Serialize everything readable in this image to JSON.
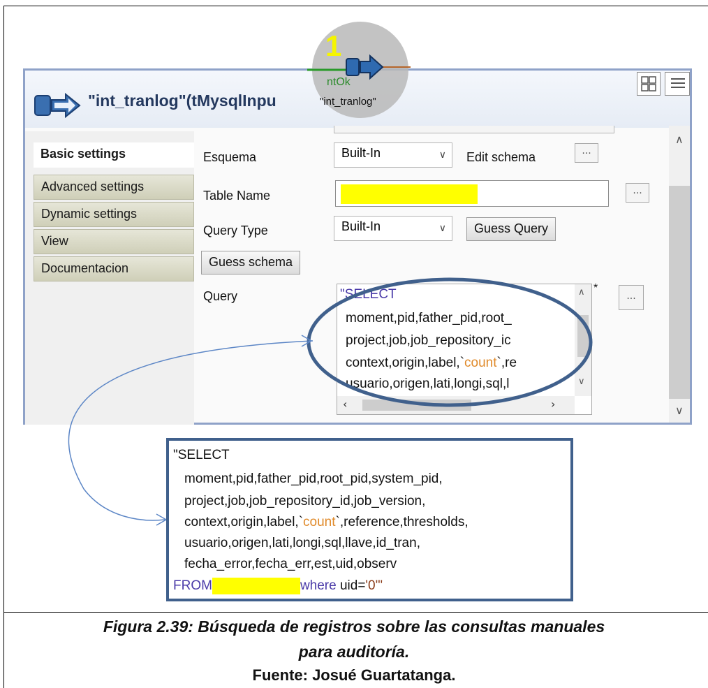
{
  "dialog": {
    "title": "\"int_tranlog\"(tMysqlInpu",
    "node_label": "\"int_tranlog\"",
    "connector_label": "ntOk",
    "step_number": "1"
  },
  "tabs": [
    {
      "label": "Basic settings"
    },
    {
      "label": "Advanced settings"
    },
    {
      "label": "Dynamic settings"
    },
    {
      "label": "View"
    },
    {
      "label": "Documentacion"
    }
  ],
  "fields": {
    "schema_label": "Esquema",
    "schema_value": "Built-In",
    "edit_schema": "Edit schema",
    "table_name_label": "Table Name",
    "query_type_label": "Query Type",
    "query_type_value": "Built-In",
    "guess_query": "Guess Query",
    "guess_schema": "Guess schema",
    "query_label": "Query",
    "dots": "...",
    "modified_marker": "*"
  },
  "query_preview": {
    "line1": "\"SELECT",
    "line2": "moment,pid,father_pid,root_",
    "line3": "project,job,job_repository_ic",
    "line4_a": "context,origin,label,`",
    "line4_b": "count",
    "line4_c": "`,re",
    "line5": "usuario,origen,lati,longi,sql,l"
  },
  "query_full": {
    "line1": "\"SELECT",
    "line2": "moment,pid,father_pid,root_pid,system_pid,",
    "line3": "project,job,job_repository_id,job_version,",
    "line4_a": "context,origin,label,`",
    "line4_b": "count",
    "line4_c": "`,reference,thresholds,",
    "line5": "usuario,origen,lati,longi,sql,llave,id_tran,",
    "line6": "fecha_error,fecha_err,est,uid,observ",
    "line7_from": "FROM",
    "line7_where": "where",
    "line7_uid": "uid=",
    "line7_value": "'0'\""
  },
  "caption": {
    "line1": "Figura 2.39: Búsqueda de registros sobre las consultas manuales",
    "line2": "para auditoría.",
    "source": "Fuente: Josué Guartatanga."
  },
  "colors": {
    "highlight": "#ffff00",
    "keyword": "#4a3aa8",
    "ellipse": "#40608c",
    "count": "#e08a2a"
  }
}
